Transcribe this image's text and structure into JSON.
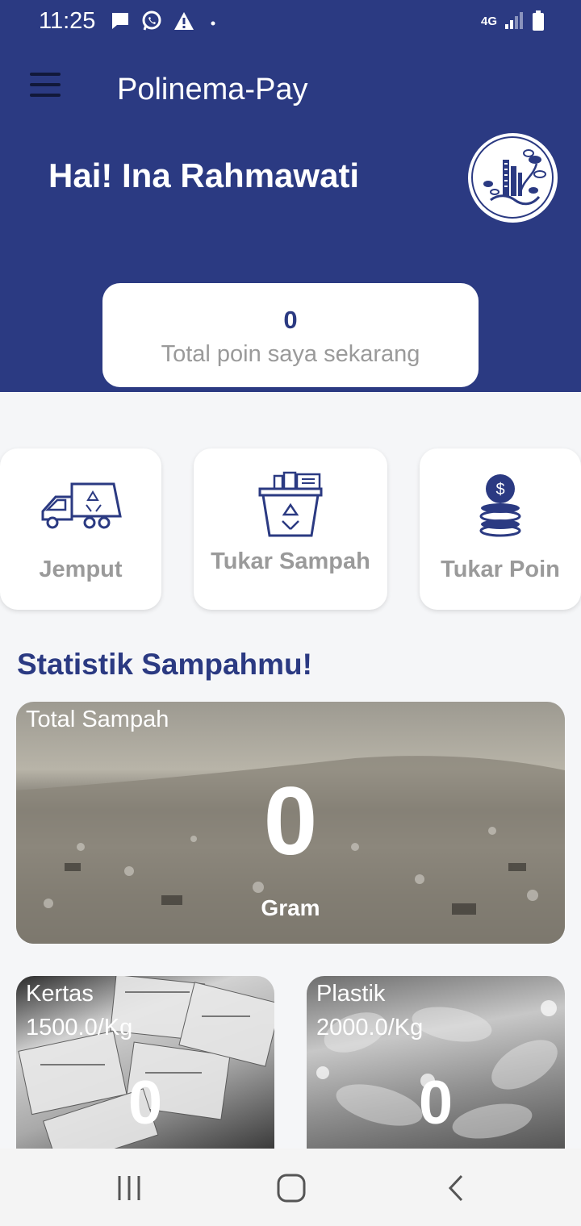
{
  "status_bar": {
    "time": "11:25",
    "network": "4G",
    "icons": [
      "message-icon",
      "whatsapp-icon",
      "warning-icon",
      "dot-icon",
      "signal-icon",
      "battery-icon"
    ]
  },
  "header": {
    "app_title": "Polinema-Pay",
    "greeting": "Hai! Ina Rahmawati"
  },
  "points": {
    "value": "0",
    "label": "Total poin saya sekarang"
  },
  "menu": [
    {
      "label": "Jemput",
      "icon": "truck-icon"
    },
    {
      "label": "Tukar Sampah",
      "icon": "recycle-bin-icon"
    },
    {
      "label": "Tukar Poin",
      "icon": "coins-icon"
    }
  ],
  "stats": {
    "title": "Statistik Sampahmu!",
    "total": {
      "label": "Total Sampah",
      "value": "0",
      "unit": "Gram"
    },
    "kertas": {
      "label": "Kertas",
      "price": "1500.0/Kg",
      "value": "0"
    },
    "plastik": {
      "label": "Plastik",
      "price": "2000.0/Kg",
      "value": "0"
    }
  },
  "colors": {
    "primary": "#2b3a82",
    "muted_text": "#9a9a9a",
    "background": "#f5f6f8"
  }
}
